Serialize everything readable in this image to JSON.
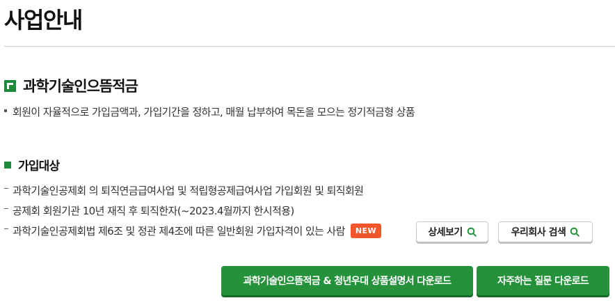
{
  "page": {
    "title": "사업안내"
  },
  "product": {
    "icon": "product-square-icon",
    "title": "과학기술인으뜸적금",
    "description": "회원이 자율적으로 가입금액과, 가입기간을 정하고, 매월 납부하여 목돈을 모으는 정기적금형 상품"
  },
  "eligibility": {
    "title": "가입대상",
    "items": [
      {
        "text": "과학기술인공제회 의 퇴직연금급여사업 및 적립형공제급여사업 가입회원 및 퇴직회원"
      },
      {
        "text": "공제회 회원기관 10년 재직 후 퇴직한자(~2023.4월까지 한시적용)"
      },
      {
        "text": "과학기술인공제회법 제6조 및 정관 제4조에 따른 일반회원 가입자격이 있는 사람",
        "badge": "NEW"
      }
    ],
    "buttons": {
      "detail_label": "상세보기",
      "company_search_label": "우리회사 검색"
    }
  },
  "actions": {
    "download_label": "과학기술인으뜸적금 & 청년우대 상품설명서 다운로드",
    "faq_label": "자주하는 질문 다운로드"
  },
  "colors": {
    "accent_green": "#26913b",
    "new_badge": "#f2562a"
  }
}
